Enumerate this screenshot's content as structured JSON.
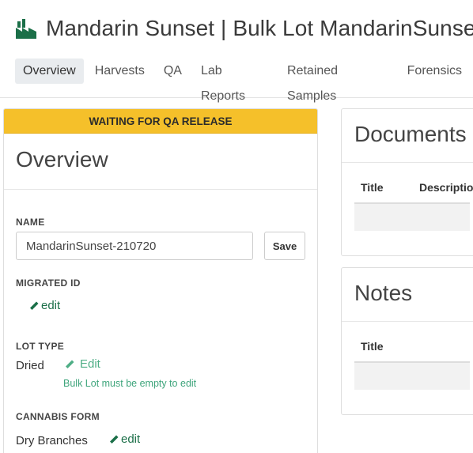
{
  "header": {
    "icon": "factory-icon",
    "title": "Mandarin Sunset | Bulk Lot MandarinSunset-"
  },
  "tabs": [
    {
      "label": "Overview",
      "active": true
    },
    {
      "label": "Harvests",
      "active": false
    },
    {
      "label": "QA",
      "active": false
    },
    {
      "label": "Lab Reports",
      "active": false
    },
    {
      "label": "Retained Samples",
      "active": false
    },
    {
      "label": "Forensics",
      "active": false
    }
  ],
  "overview": {
    "status_banner": "WAITING FOR QA RELEASE",
    "heading": "Overview",
    "name": {
      "label": "NAME",
      "value": "MandarinSunset-210720",
      "save_label": "Save"
    },
    "migrated_id": {
      "label": "MIGRATED ID",
      "edit_label": "edit"
    },
    "lot_type": {
      "label": "LOT TYPE",
      "value": "Dried",
      "edit_label": "Edit",
      "hint": "Bulk Lot must be empty to edit"
    },
    "cannabis_form": {
      "label": "CANNABIS FORM",
      "value": "Dry Branches",
      "edit_label": "edit"
    }
  },
  "documents": {
    "heading": "Documents",
    "columns": [
      "Title",
      "Description"
    ]
  },
  "notes": {
    "heading": "Notes",
    "columns": [
      "Title"
    ]
  },
  "colors": {
    "banner": "#f5c02a",
    "link": "#1b6f48",
    "link_light": "#4fae86",
    "tab_active_bg": "#e9ecef"
  }
}
